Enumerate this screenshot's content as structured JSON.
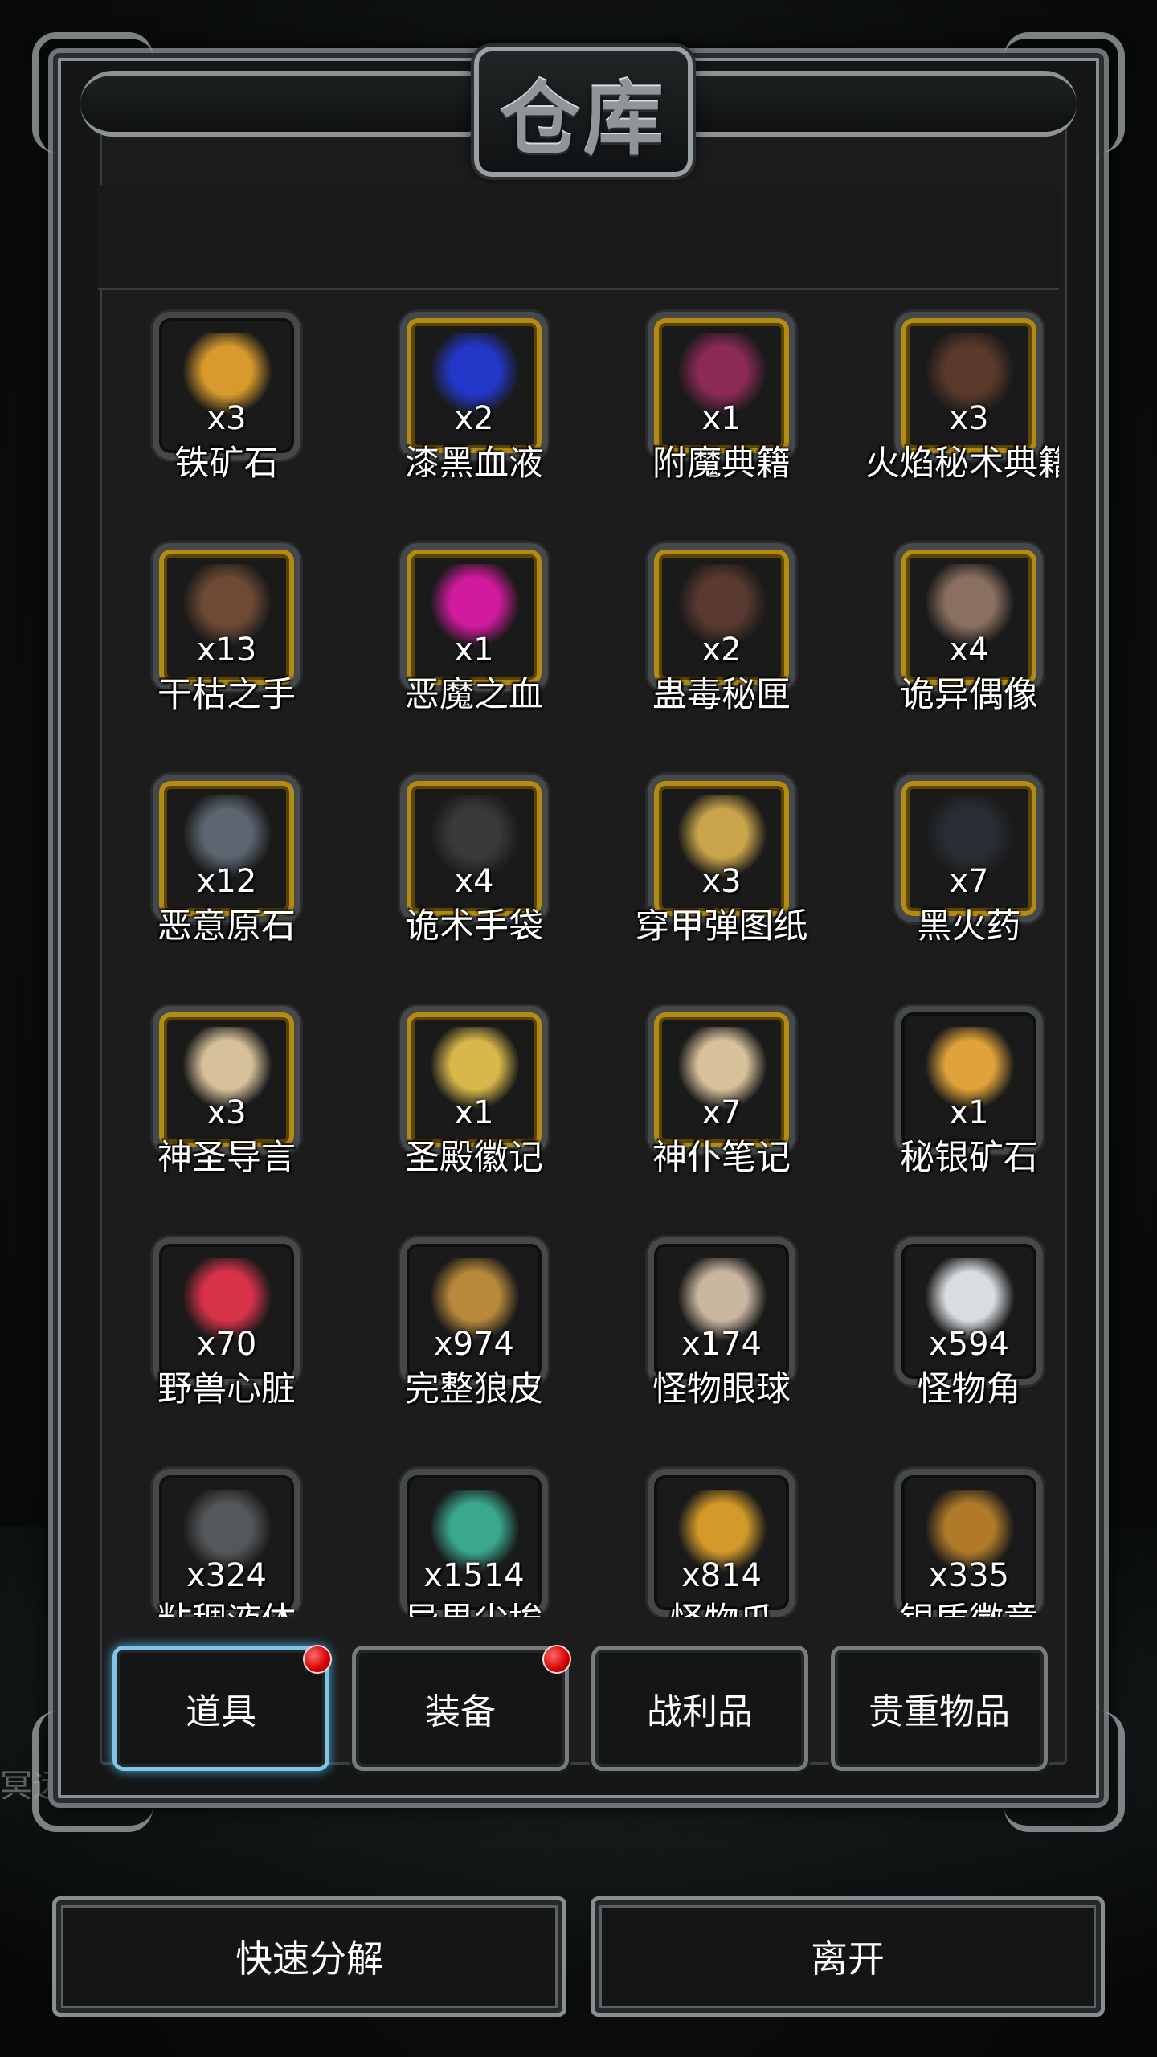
{
  "title": "仓库",
  "side_text": "冥远",
  "items": [
    {
      "name": "铁矿石",
      "count": "x3",
      "gold": false,
      "color": "#d89a2c",
      "shape": "ore-icon"
    },
    {
      "name": "漆黑血液",
      "count": "x2",
      "gold": true,
      "color": "#2337c9",
      "shape": "dark-blood-icon"
    },
    {
      "name": "附魔典籍",
      "count": "x1",
      "gold": true,
      "color": "#8a2a55",
      "shape": "enchant-book-icon"
    },
    {
      "name": "火焰秘术典籍",
      "count": "x3",
      "gold": true,
      "color": "#5a3a2a",
      "shape": "fire-book-icon"
    },
    {
      "name": "干枯之手",
      "count": "x13",
      "gold": true,
      "color": "#6e4a35",
      "shape": "withered-hand-icon"
    },
    {
      "name": "恶魔之血",
      "count": "x1",
      "gold": true,
      "color": "#d21a9e",
      "shape": "demon-blood-icon"
    },
    {
      "name": "蛊毒秘匣",
      "count": "x2",
      "gold": true,
      "color": "#5a3a30",
      "shape": "poison-box-icon"
    },
    {
      "name": "诡异偶像",
      "count": "x4",
      "gold": true,
      "color": "#8a7060",
      "shape": "idol-icon"
    },
    {
      "name": "恶意原石",
      "count": "x12",
      "gold": true,
      "color": "#5b6670",
      "shape": "malice-stone-icon"
    },
    {
      "name": "诡术手袋",
      "count": "x4",
      "gold": true,
      "color": "#3a3a3a",
      "shape": "trick-bag-icon"
    },
    {
      "name": "穿甲弹图纸",
      "count": "x3",
      "gold": true,
      "color": "#c9a44a",
      "shape": "blueprint-icon"
    },
    {
      "name": "黑火药",
      "count": "x7",
      "gold": true,
      "color": "#2a2e34",
      "shape": "black-powder-icon"
    },
    {
      "name": "神圣导言",
      "count": "x3",
      "gold": true,
      "color": "#d7c19a",
      "shape": "holy-scroll-icon"
    },
    {
      "name": "圣殿徽记",
      "count": "x1",
      "gold": true,
      "color": "#d8b84a",
      "shape": "temple-emblem-icon"
    },
    {
      "name": "神仆笔记",
      "count": "x7",
      "gold": true,
      "color": "#d7c19a",
      "shape": "servant-notes-icon"
    },
    {
      "name": "秘银矿石",
      "count": "x1",
      "gold": false,
      "color": "#e0a23a",
      "shape": "mithril-ore-icon"
    },
    {
      "name": "野兽心脏",
      "count": "x70",
      "gold": false,
      "color": "#d9334a",
      "shape": "beast-heart-icon"
    },
    {
      "name": "完整狼皮",
      "count": "x974",
      "gold": false,
      "color": "#b8893a",
      "shape": "wolf-pelt-icon"
    },
    {
      "name": "怪物眼球",
      "count": "x174",
      "gold": false,
      "color": "#c9b7a0",
      "shape": "eyeball-icon"
    },
    {
      "name": "怪物角",
      "count": "x594",
      "gold": false,
      "color": "#dadde0",
      "shape": "horn-icon"
    },
    {
      "name": "粘稠液体",
      "count": "x324",
      "gold": false,
      "color": "#55585a",
      "shape": "liquid-icon"
    },
    {
      "name": "异界尘埃",
      "count": "x1514",
      "gold": false,
      "color": "#3aa88e",
      "shape": "dust-icon"
    },
    {
      "name": "怪物爪",
      "count": "x814",
      "gold": false,
      "color": "#d39a2a",
      "shape": "claw-icon"
    },
    {
      "name": "银质徽章",
      "count": "x335",
      "gold": false,
      "color": "#b07a2a",
      "shape": "silver-badge-icon"
    }
  ],
  "tabs": [
    {
      "label": "道具",
      "active": true,
      "dot": true
    },
    {
      "label": "装备",
      "active": false,
      "dot": true
    },
    {
      "label": "战利品",
      "active": false,
      "dot": false
    },
    {
      "label": "贵重物品",
      "active": false,
      "dot": false
    }
  ],
  "buttons": {
    "decompose": "快速分解",
    "leave": "离开"
  }
}
